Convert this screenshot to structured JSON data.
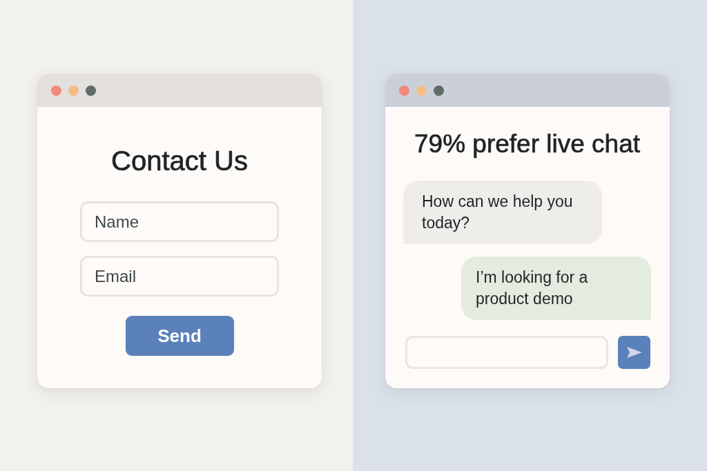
{
  "contact_window": {
    "title": "Contact Us",
    "fields": [
      {
        "placeholder": "Name"
      },
      {
        "placeholder": "Email"
      }
    ],
    "submit_button": "Send"
  },
  "chat_window": {
    "title": "79% prefer live chat",
    "messages": [
      {
        "kind": "incoming",
        "text": "How can we help you today?"
      },
      {
        "kind": "outgoing",
        "text": "I’m looking for a product demo"
      }
    ]
  }
}
